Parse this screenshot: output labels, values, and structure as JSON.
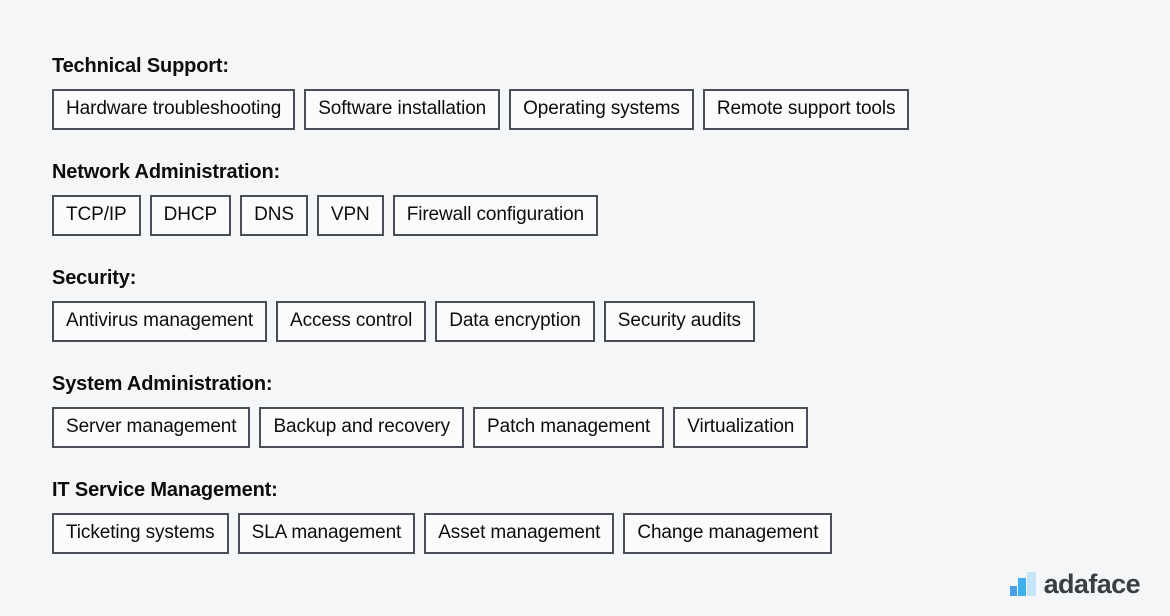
{
  "page": {
    "background_color": "#f4f6f8",
    "text_color": "#0d0d0d",
    "pill_border_color": "#4a4f57",
    "pill_fill_color": "#fbfbfc"
  },
  "sections": [
    {
      "heading": "Technical Support:",
      "items": [
        "Hardware troubleshooting",
        "Software installation",
        "Operating systems",
        "Remote support tools"
      ]
    },
    {
      "heading": "Network Administration:",
      "items": [
        "TCP/IP",
        "DHCP",
        "DNS",
        "VPN",
        "Firewall configuration"
      ]
    },
    {
      "heading": "Security:",
      "items": [
        "Antivirus management",
        "Access control",
        "Data encryption",
        "Security audits"
      ]
    },
    {
      "heading": "System Administration:",
      "items": [
        "Server management",
        "Backup and recovery",
        "Patch management",
        "Virtualization"
      ]
    },
    {
      "heading": "IT Service Management:",
      "items": [
        "Ticketing systems",
        "SLA management",
        "Asset management",
        "Change management"
      ]
    }
  ],
  "logo": {
    "text": "adaface",
    "icon": "bar-chart-icon",
    "text_color": "#3a3f46",
    "bar_colors": [
      "#4a9ee8",
      "#3db0ef",
      "#c5e4f7"
    ]
  }
}
